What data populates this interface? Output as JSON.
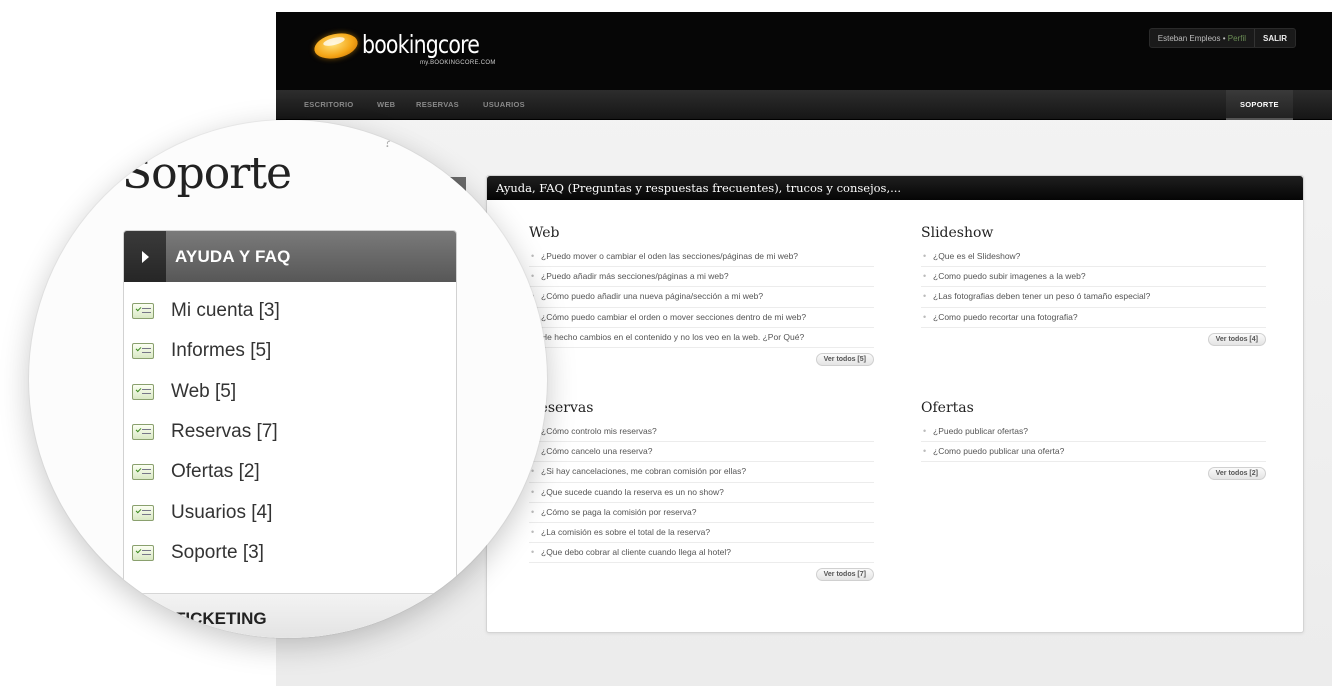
{
  "header": {
    "logo_name": "bookingcore",
    "logo_sub": "my.BOOKINGCORE.COM",
    "user_name": "Esteban Empleos",
    "user_sep": "•",
    "profile_link": "Perfil",
    "logout": "SALIR"
  },
  "nav": {
    "items": [
      "ESCRITORIO",
      "WEB",
      "RESERVAS",
      "USUARIOS"
    ],
    "active": "SOPORTE"
  },
  "colors": {
    "header_bg": "#060606",
    "accent_orange": "#f5a718",
    "icon_green": "#3b8a1e"
  },
  "magnifier": {
    "title": "Soporte",
    "ghost_text": "?",
    "section_active": "AYUDA Y FAQ",
    "menu": [
      {
        "label": "Mi cuenta [3]",
        "icon": "checklist-icon"
      },
      {
        "label": "Informes [5]",
        "icon": "checklist-icon"
      },
      {
        "label": "Web [5]",
        "icon": "checklist-icon"
      },
      {
        "label": "Reservas [7]",
        "icon": "checklist-icon"
      },
      {
        "label": "Ofertas [2]",
        "icon": "checklist-icon"
      },
      {
        "label": "Usuarios [4]",
        "icon": "checklist-icon"
      },
      {
        "label": "Soporte [3]",
        "icon": "checklist-icon"
      }
    ],
    "section_collapsed": "TICKETING"
  },
  "faq": {
    "title": "Ayuda, FAQ (Preguntas y respuestas frecuentes), trucos y consejos,...",
    "sections": [
      {
        "title": "Web",
        "items": [
          "¿Puedo mover o cambiar el oden las secciones/páginas de mi web?",
          "¿Puedo añadir más secciones/páginas a mi web?",
          "¿Cómo puedo añadir una nueva página/sección a mi web?",
          "¿Cómo puedo cambiar el orden o mover secciones dentro de mi web?",
          "He hecho cambios en el contenido y no los veo en la web. ¿Por Qué?"
        ],
        "more": "Ver todos [5]"
      },
      {
        "title": "Slideshow",
        "items": [
          "¿Que es el Slideshow?",
          "¿Como puedo subir imagenes a la web?",
          "¿Las fotografias deben tener un peso ó tamaño especial?",
          "¿Como puedo recortar una fotografia?"
        ],
        "more": "Ver todos [4]"
      },
      {
        "title": "Reservas",
        "items": [
          "¿Cómo controlo mis reservas?",
          "¿Cómo cancelo una reserva?",
          "¿Si hay cancelaciones, me cobran comisión por ellas?",
          "¿Que sucede cuando la reserva es un no show?",
          "¿Cómo se paga la comisión por reserva?",
          "¿La comisión es sobre el total de la reserva?",
          "¿Que debo cobrar al cliente cuando llega al hotel?"
        ],
        "more": "Ver todos [7]"
      },
      {
        "title": "Ofertas",
        "items": [
          "¿Puedo publicar ofertas?",
          "¿Como puedo publicar una oferta?"
        ],
        "more": "Ver todos [2]"
      }
    ]
  }
}
